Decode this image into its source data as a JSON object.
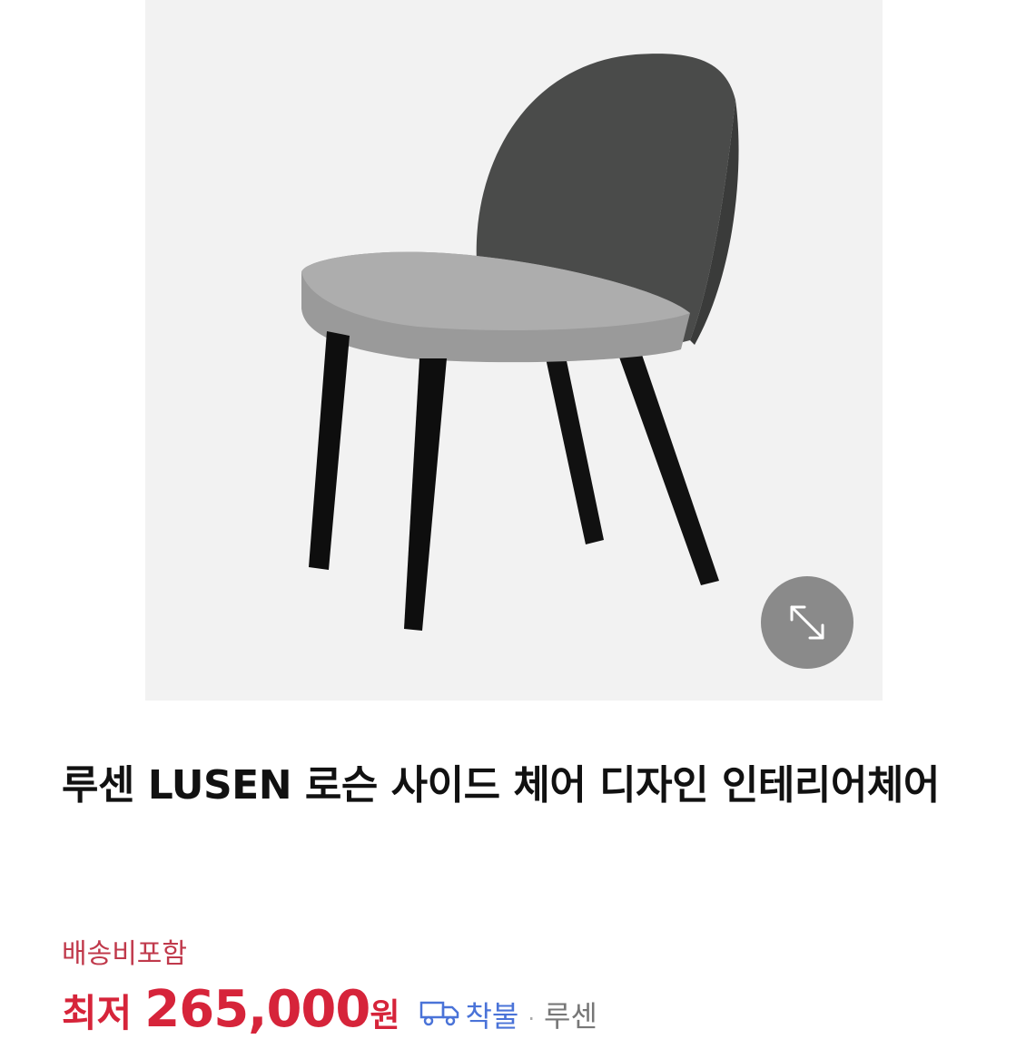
{
  "product": {
    "title": "루센 LUSEN 로슨 사이드 체어 디자인 인테리어체어",
    "image_icon": "chair-product-image"
  },
  "expand_button": {
    "icon": "expand-arrows-icon"
  },
  "shipping_note": "배송비포함",
  "price": {
    "label": "최저",
    "value": "265,000",
    "unit": "원"
  },
  "delivery": {
    "icon": "truck-icon",
    "label": "착불",
    "separator": "·",
    "seller": "루센"
  },
  "colors": {
    "price": "#d6243a",
    "shipping": "#c0394b",
    "delivery": "#4a73d8"
  }
}
